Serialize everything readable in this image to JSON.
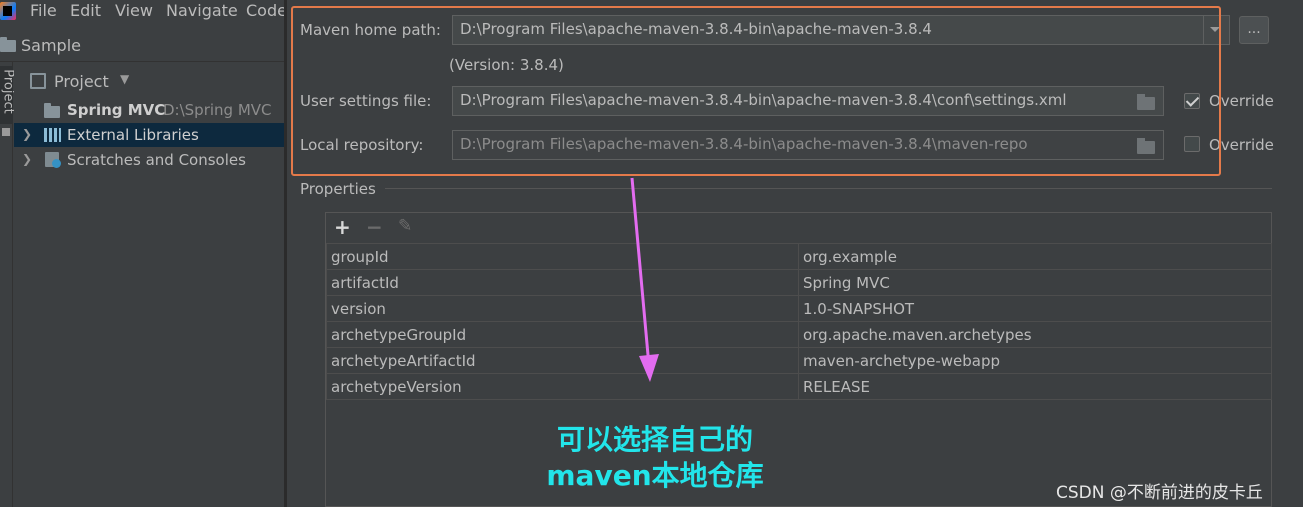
{
  "menu": {
    "file": "File",
    "edit": "Edit",
    "view": "View",
    "navigate": "Navigate",
    "code": "Code"
  },
  "window": {
    "project_name": "Sample"
  },
  "side_tab": {
    "label": "Project"
  },
  "project_panel": {
    "view_selector": "Project",
    "items": [
      {
        "name": "Spring MVC",
        "path": "D:\\Spring MVC"
      },
      {
        "name": "External Libraries"
      },
      {
        "name": "Scratches and Consoles"
      }
    ]
  },
  "maven": {
    "home_label": "Maven home path:",
    "home_value": "D:\\Program Files\\apache-maven-3.8.4-bin\\apache-maven-3.8.4",
    "browse_label": "...",
    "version_text": "(Version: 3.8.4)",
    "settings_label": "User settings file:",
    "settings_value": "D:\\Program Files\\apache-maven-3.8.4-bin\\apache-maven-3.8.4\\conf\\settings.xml",
    "settings_override_label": "Override",
    "settings_override_checked": true,
    "repo_label": "Local repository:",
    "repo_value": "D:\\Program Files\\apache-maven-3.8.4-bin\\apache-maven-3.8.4\\maven-repo",
    "repo_override_label": "Override",
    "repo_override_checked": false
  },
  "properties": {
    "section_title": "Properties",
    "toolbar": {
      "add": "+",
      "remove": "−",
      "edit": "✎"
    },
    "rows": [
      {
        "key": "groupId",
        "value": "org.example"
      },
      {
        "key": "artifactId",
        "value": "Spring MVC"
      },
      {
        "key": "version",
        "value": "1.0-SNAPSHOT"
      },
      {
        "key": "archetypeGroupId",
        "value": "org.apache.maven.archetypes"
      },
      {
        "key": "archetypeArtifactId",
        "value": "maven-archetype-webapp"
      },
      {
        "key": "archetypeVersion",
        "value": "RELEASE"
      }
    ]
  },
  "annotation": {
    "line1": "可以选择自己的",
    "line2": "maven本地仓库",
    "box_color": "#e47a4a",
    "arrow_color": "#e36cf0",
    "text_color": "#22e5ea"
  },
  "watermark": "CSDN @不断前进的皮卡丘"
}
